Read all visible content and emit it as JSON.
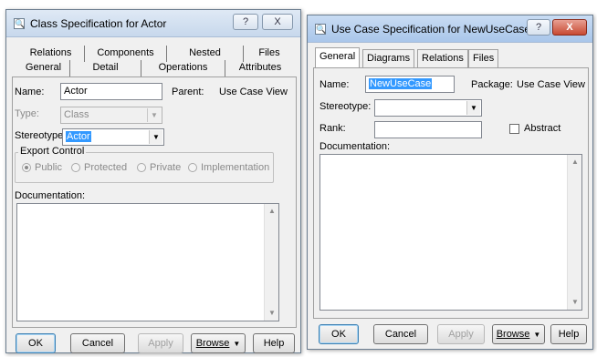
{
  "left_dialog": {
    "title": "Class Specification for Actor",
    "titlebar_buttons": {
      "help": "?",
      "close": "X"
    },
    "tabs_row1": [
      "Relations",
      "Components",
      "Nested",
      "Files"
    ],
    "tabs_row2": [
      "General",
      "Detail",
      "Operations",
      "Attributes"
    ],
    "name_label": "Name:",
    "name_value": "Actor",
    "parent_label": "Parent:",
    "parent_value": "Use Case View",
    "type_label": "Type:",
    "type_value": "Class",
    "stereotype_label": "Stereotype:",
    "stereotype_value": "Actor",
    "export_control_label": "Export Control",
    "export_options": [
      "Public",
      "Protected",
      "Private",
      "Implementation"
    ],
    "export_selected": "Public",
    "documentation_label": "Documentation:",
    "buttons": {
      "ok": "OK",
      "cancel": "Cancel",
      "apply": "Apply",
      "browse": "Browse",
      "help": "Help"
    }
  },
  "right_dialog": {
    "title": "Use Case Specification for NewUseCase",
    "titlebar_buttons": {
      "help": "?",
      "close": "X"
    },
    "tabs": [
      "General",
      "Diagrams",
      "Relations",
      "Files"
    ],
    "active_tab": "General",
    "name_label": "Name:",
    "name_value": "NewUseCase",
    "package_label": "Package:",
    "package_value": "Use Case View",
    "stereotype_label": "Stereotype:",
    "stereotype_value": "",
    "rank_label": "Rank:",
    "rank_value": "",
    "abstract_label": "Abstract",
    "abstract_checked": false,
    "documentation_label": "Documentation:",
    "buttons": {
      "ok": "OK",
      "cancel": "Cancel",
      "apply": "Apply",
      "browse": "Browse",
      "help": "Help"
    }
  }
}
